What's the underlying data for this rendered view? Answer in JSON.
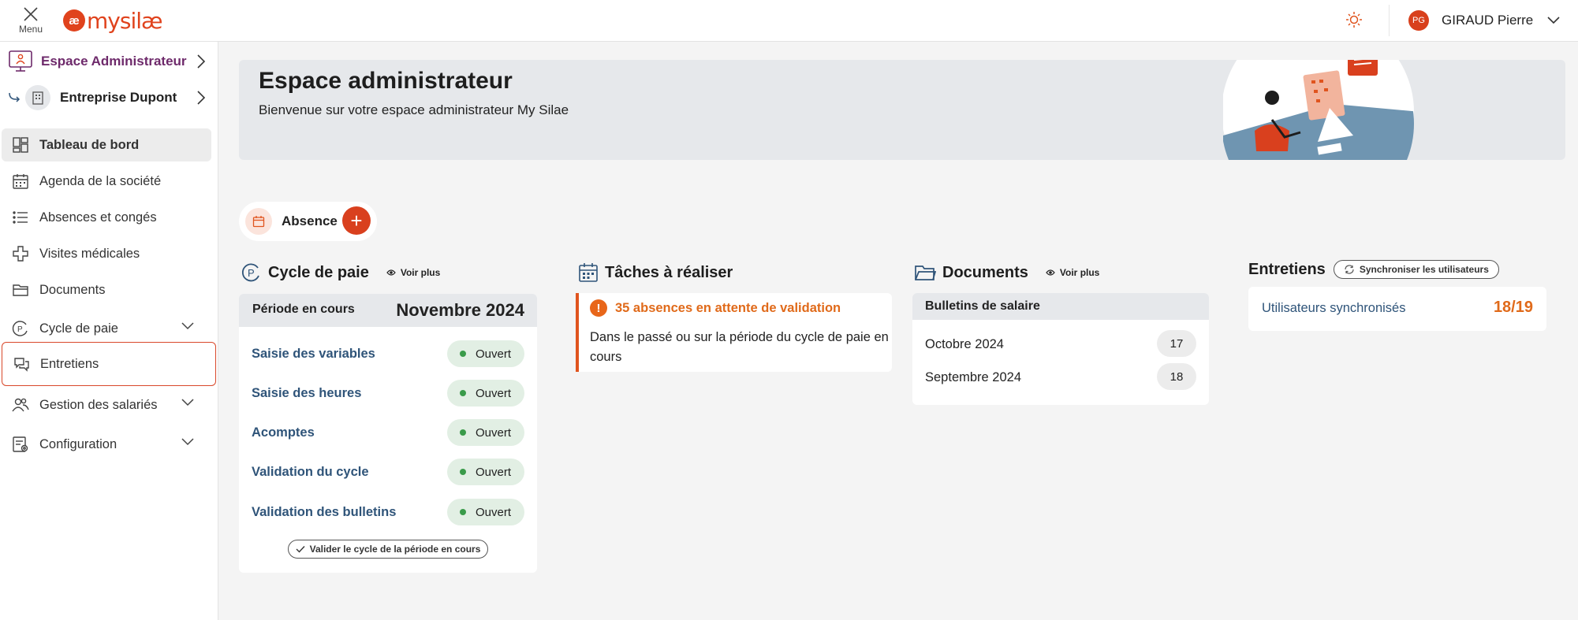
{
  "topbar": {
    "menu_label": "Menu",
    "logo_mark": "æ",
    "logo_my": "my",
    "logo_name": "silæ",
    "user_initials": "PG",
    "user_name": "GIRAUD Pierre"
  },
  "sidebar": {
    "space": "Espace Administrateur",
    "company": "Entreprise Dupont",
    "items": [
      {
        "label": "Tableau de bord",
        "icon": "dashboard-icon"
      },
      {
        "label": "Agenda de la société",
        "icon": "calendar-icon"
      },
      {
        "label": "Absences et congés",
        "icon": "list-icon"
      },
      {
        "label": "Visites médicales",
        "icon": "medical-cross-icon"
      },
      {
        "label": "Documents",
        "icon": "folder-icon"
      },
      {
        "label": "Cycle de paie",
        "icon": "payroll-cycle-icon"
      },
      {
        "label": "Entretiens",
        "icon": "chat-bubbles-icon"
      },
      {
        "label": "Gestion des salariés",
        "icon": "people-icon"
      },
      {
        "label": "Configuration",
        "icon": "settings-form-icon"
      }
    ]
  },
  "banner": {
    "title": "Espace administrateur",
    "subtitle": "Bienvenue sur votre espace administrateur My Silae"
  },
  "quick_action": {
    "label": "Absence",
    "plus": "+"
  },
  "cycle": {
    "title": "Cycle de paie",
    "voir_plus": "Voir plus",
    "period_label": "Période en cours",
    "period_value": "Novembre 2024",
    "steps": [
      {
        "name": "Saisie des variables",
        "status": "Ouvert"
      },
      {
        "name": "Saisie des heures",
        "status": "Ouvert"
      },
      {
        "name": "Acomptes",
        "status": "Ouvert"
      },
      {
        "name": "Validation du cycle",
        "status": "Ouvert"
      },
      {
        "name": "Validation des bulletins",
        "status": "Ouvert"
      }
    ],
    "validate_button": "Valider le cycle de la période en cours"
  },
  "tasks": {
    "title": "Tâches à réaliser",
    "alert_title": "35 absences en attente de validation",
    "alert_text": "Dans le passé ou sur la période du cycle de paie en cours"
  },
  "documents": {
    "title": "Documents",
    "voir_plus": "Voir plus",
    "section": "Bulletins de salaire",
    "rows": [
      {
        "name": "Octobre 2024",
        "count": "17"
      },
      {
        "name": "Septembre 2024",
        "count": "18"
      }
    ]
  },
  "entretiens": {
    "title": "Entretiens",
    "sync_button": "Synchroniser les utilisateurs",
    "row_label": "Utilisateurs synchronisés",
    "row_value": "18/19"
  },
  "colors": {
    "accent": "#e0431d",
    "link": "#2f5479",
    "warning": "#e06a1a",
    "status_green": "#3a9b4a"
  }
}
